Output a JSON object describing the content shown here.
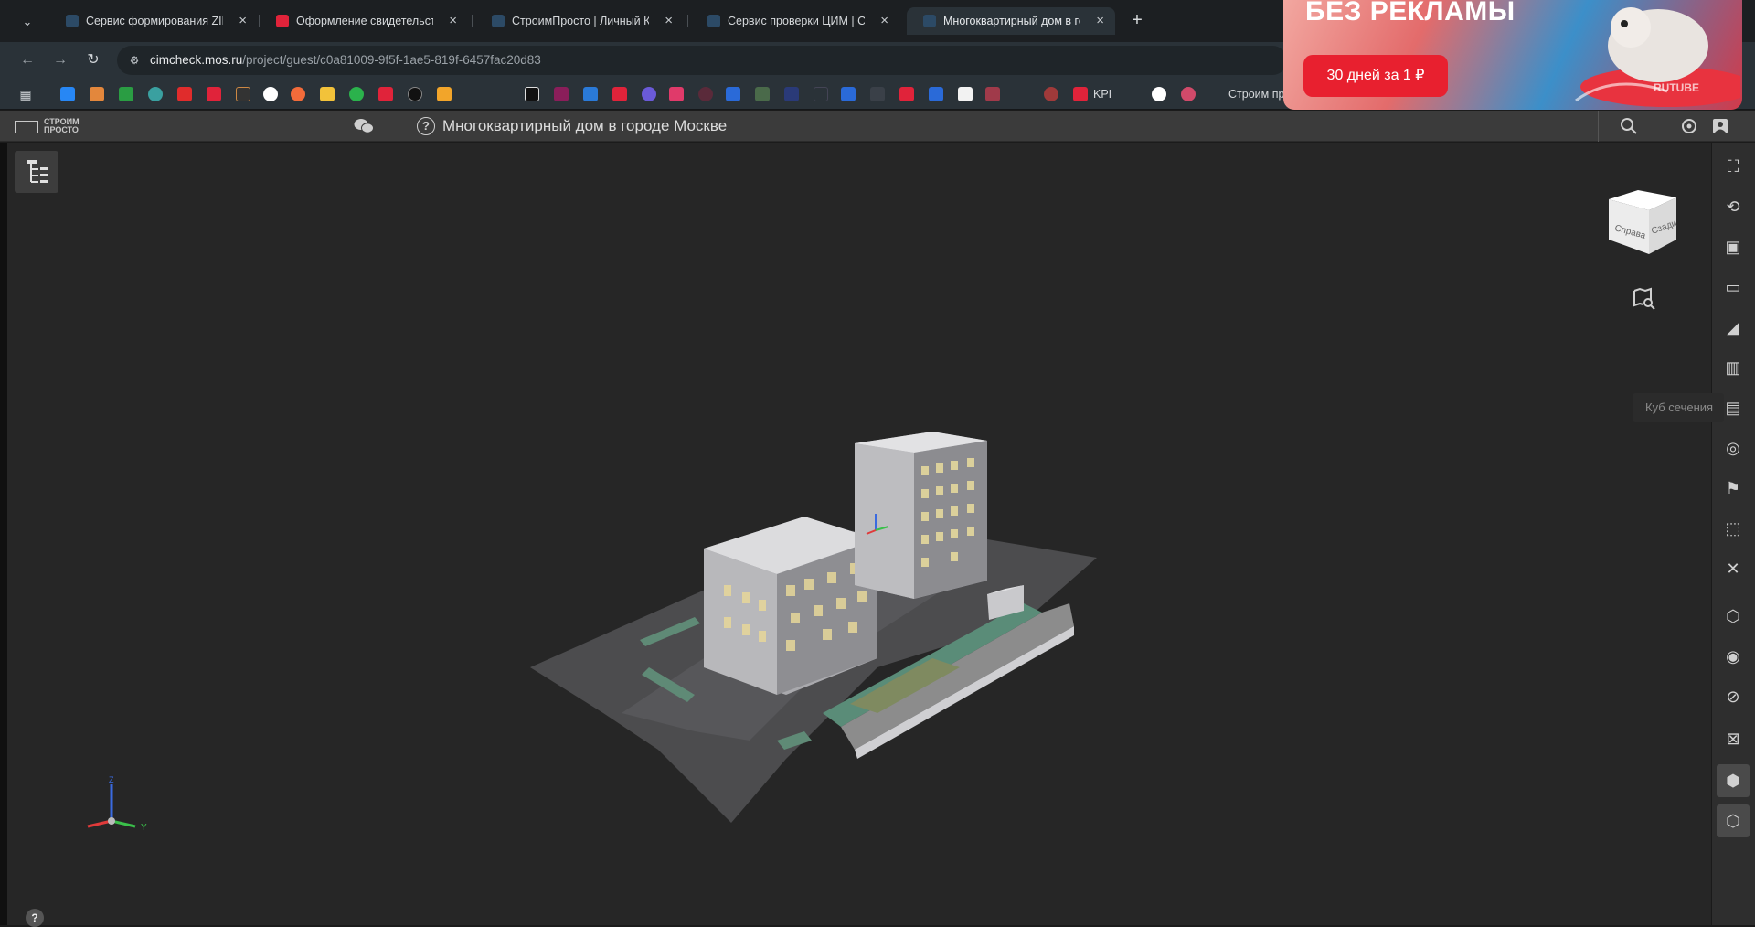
{
  "browser": {
    "tabs": [
      {
        "title": "Сервис формирования ZIP ар",
        "favicon_color": "#2c4a66",
        "active": false
      },
      {
        "title": "Оформление свидетельства о",
        "favicon_color": "#e0233a",
        "active": false
      },
      {
        "title": "СтроимПросто | Личный Каби",
        "favicon_color": "#2c4a66",
        "active": false
      },
      {
        "title": "Сервис проверки ЦИМ | СТРС",
        "favicon_color": "#2c4a66",
        "active": false
      },
      {
        "title": "Многоквартирный дом в горо",
        "favicon_color": "#2c4a66",
        "active": true
      }
    ],
    "new_tab_label": "+",
    "close_label": "×",
    "url_domain": "cimcheck.mos.ru",
    "url_path": "/project/guest/c0a81009-9f5f-1ae5-819f-6457fac20d83",
    "bookmarks": {
      "kpi_label": "KPI",
      "stroim_label": "Строим пр"
    }
  },
  "ad": {
    "title": "БЕЗ РЕКЛАМЫ",
    "button_label": "30 дней за 1 ₽",
    "brand": "RUTUBE"
  },
  "app": {
    "logo_line1": "СТРОИМ",
    "logo_line2": "ПРОСТО",
    "project_title": "Многоквартирный дом в городе Москве",
    "help_label": "?",
    "tooltip": "Куб сечения",
    "viewcube": {
      "left_face": "Справа",
      "right_face": "Сзади"
    },
    "axes": {
      "y_label": "Y",
      "z_label": "Z"
    }
  }
}
